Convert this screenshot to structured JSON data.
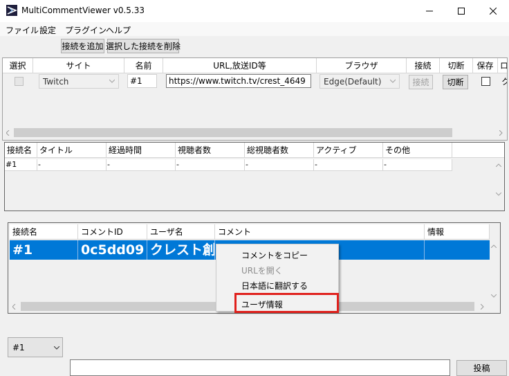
{
  "window": {
    "title": "MultiCommentViewer v0.5.33",
    "icon": "app-logo-icon"
  },
  "menu": [
    "ファイル",
    "設定",
    "プラグイン",
    "ヘルプ"
  ],
  "toolbar": {
    "add_connection": "接続を追加",
    "remove_selected": "選択した接続を削除"
  },
  "connections": {
    "headers": [
      "選択",
      "サイト",
      "名前",
      "URL,放送ID等",
      "ブラウザ",
      "接続",
      "切断",
      "保存",
      "ロ"
    ],
    "row": {
      "selected": false,
      "site": "Twitch",
      "name": "#1",
      "url": "https://www.twitch.tv/crest_4649",
      "browser": "Edge(Default)",
      "connect_label": "接続",
      "disconnect_label": "切断",
      "save": false,
      "extra": "ク"
    }
  },
  "info": {
    "headers": [
      "接続名",
      "タイトル",
      "経過時間",
      "視聴者数",
      "総視聴者数",
      "アクティブ",
      "その他"
    ],
    "row": [
      "#1",
      "-",
      "-",
      "-",
      "-",
      "-",
      "-"
    ]
  },
  "comments": {
    "headers": [
      "接続名",
      "コメントID",
      "ユーザ名",
      "コメント",
      "情報"
    ],
    "rows": [
      {
        "connection": "#1",
        "comment_id": "0c5dd09",
        "user": "クレスト創",
        "comment": "",
        "info": ""
      }
    ]
  },
  "context_menu": {
    "items": [
      {
        "label": "コメントをコピー",
        "enabled": true
      },
      {
        "label": "URLを開く",
        "enabled": false
      },
      {
        "label": "日本語に翻訳する",
        "enabled": true
      },
      {
        "label": "ユーザ情報",
        "enabled": true,
        "highlighted": true
      }
    ]
  },
  "bottom": {
    "connection_select": "#1",
    "comment_input": "",
    "post_label": "投稿"
  },
  "colors": {
    "selection": "#0078d7",
    "highlight_border": "#e0201c"
  }
}
